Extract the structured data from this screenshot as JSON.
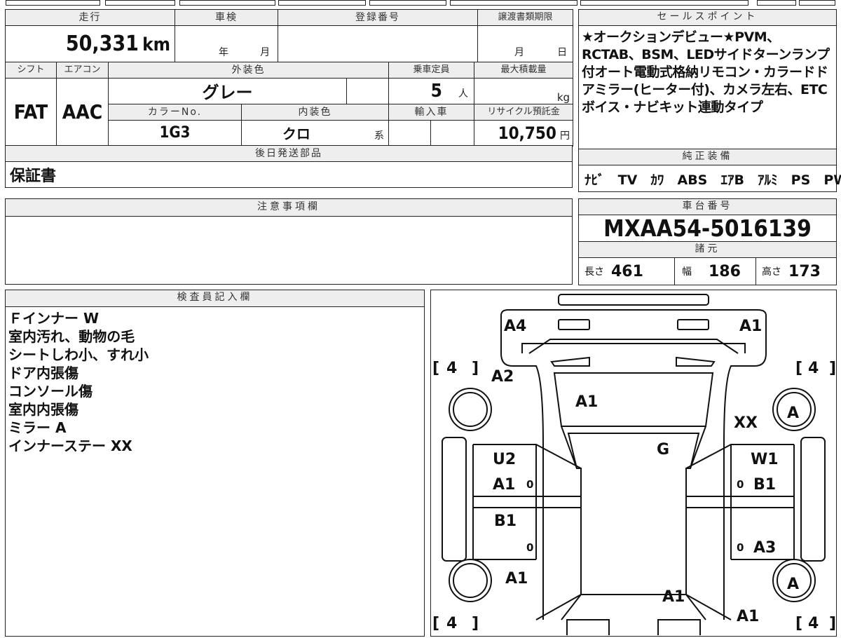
{
  "top_left": {
    "headers": {
      "mileage": "走行",
      "inspection": "車検",
      "registration": "登録番号",
      "transfer_deadline": "譲渡書類期限"
    },
    "mileage_value": "50,331",
    "mileage_unit": "km",
    "inspection_year_unit": "年",
    "inspection_month_unit": "月",
    "transfer_month_unit": "月",
    "transfer_day_unit": "日",
    "row2_headers": {
      "shift": "シフト",
      "aircon": "エアコン",
      "exterior_color": "外装色",
      "capacity": "乗車定員",
      "max_load": "最大積載量"
    },
    "shift_value": "FAT",
    "aircon_value": "AAC",
    "exterior_color_value": "グレー",
    "capacity_value": "5",
    "capacity_unit": "人",
    "max_load_unit": "kg",
    "row3_headers": {
      "color_no": "カラーNo.",
      "interior_color": "内装色",
      "import": "輸入車",
      "recycle": "リサイクル預託金"
    },
    "color_no_value": "1G3",
    "interior_color_value": "クロ",
    "interior_suffix": "系",
    "recycle_value": "10,750",
    "recycle_unit": "円",
    "later_parts_header": "後日発送部品",
    "later_parts_value": "保証書"
  },
  "sales_points": {
    "title": "セールスポイント",
    "text": "★オークションデビュー★PVM、RCTAB、BSM、LEDサイドターンランプ付オート電動式格納リモコン・カラードドアミラー(ヒーター付)、カメラ左右、ETCボイス・ナビキット連動タイプ"
  },
  "equipment": {
    "title": "純正装備",
    "items": [
      "ﾅﾋﾞ",
      "TV",
      "ｶﾜ",
      "ABS",
      "ｴｱB",
      "ｱﾙﾐ",
      "PS",
      "PW"
    ]
  },
  "notes": {
    "title": "注意事項欄"
  },
  "chassis": {
    "title": "車台番号",
    "value": "MXAA54-5016139"
  },
  "specs": {
    "title": "諸元",
    "length_label": "長さ",
    "length_value": "461",
    "width_label": "幅",
    "width_value": "186",
    "height_label": "高さ",
    "height_value": "173"
  },
  "inspector": {
    "title": "検査員記入欄",
    "lines": [
      "Ｆインナー W",
      "室内汚れ、動物の毛",
      "シートしわ小、すれ小",
      "ドア内張傷",
      "コンソール傷",
      "室内内張傷",
      "ミラー A",
      "インナーステー XX"
    ]
  },
  "diagram": {
    "tire_tread": [
      "4",
      "4",
      "4",
      "4"
    ],
    "marks": [
      {
        "text": "A4"
      },
      {
        "text": "A1"
      },
      {
        "text": "A2"
      },
      {
        "text": "A1"
      },
      {
        "text": "XX"
      },
      {
        "text": "A"
      },
      {
        "text": "G"
      },
      {
        "text": "U2"
      },
      {
        "text": "W1"
      },
      {
        "text": "A1"
      },
      {
        "text": "B1"
      },
      {
        "text": "B1"
      },
      {
        "text": "A3"
      },
      {
        "text": "A1"
      },
      {
        "text": "A"
      },
      {
        "text": "A1"
      },
      {
        "text": "A1"
      }
    ],
    "zeros": [
      "0",
      "0",
      "0",
      "0"
    ]
  }
}
